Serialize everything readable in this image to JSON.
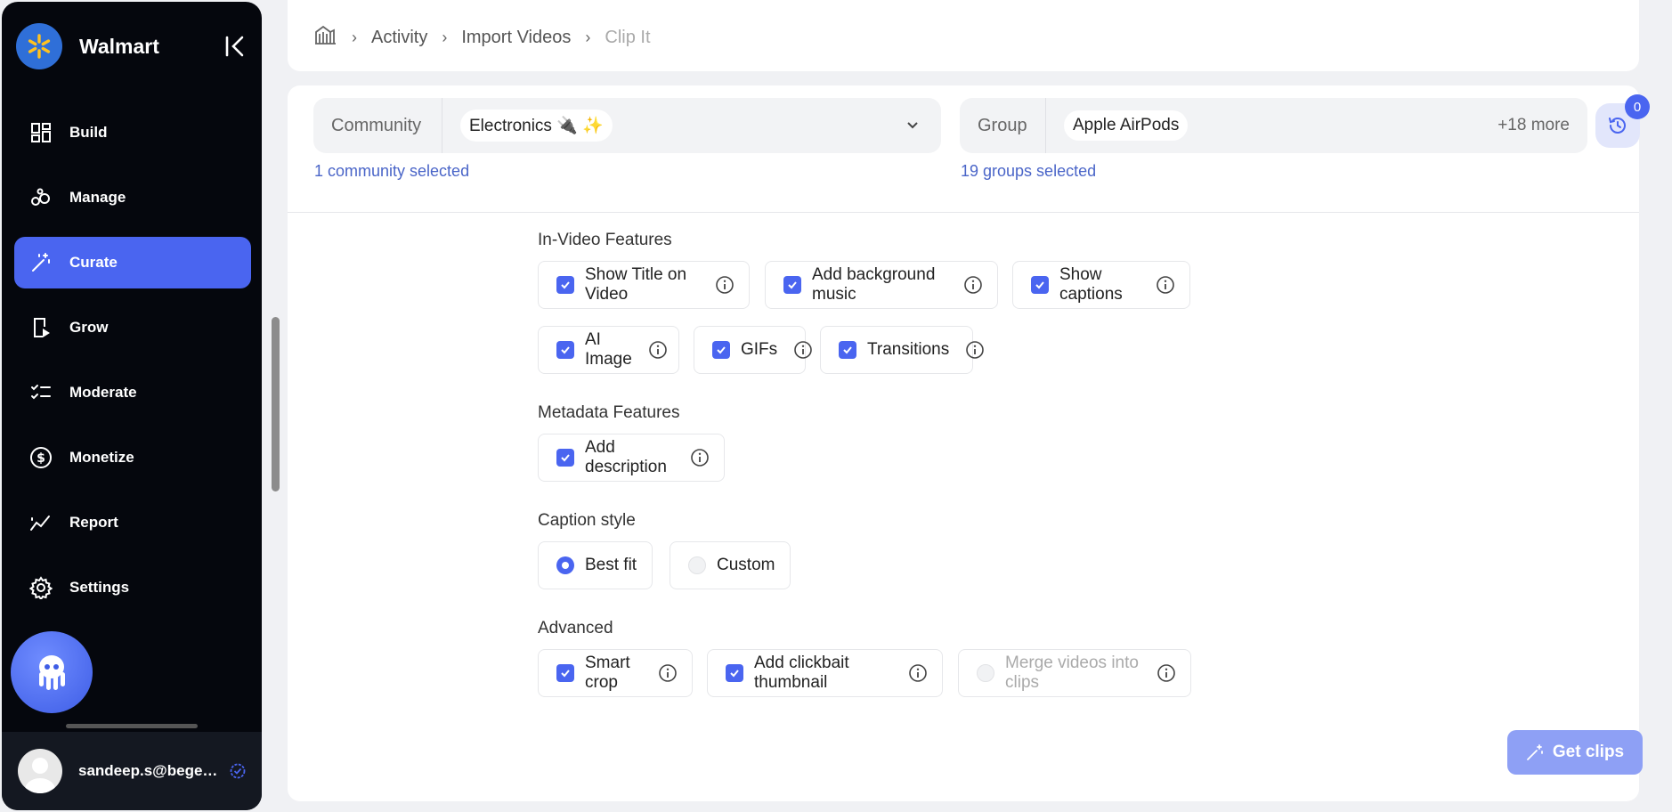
{
  "sidebar": {
    "brand": "Walmart",
    "items": [
      {
        "label": "Build"
      },
      {
        "label": "Manage"
      },
      {
        "label": "Curate"
      },
      {
        "label": "Grow"
      },
      {
        "label": "Moderate"
      },
      {
        "label": "Monetize"
      },
      {
        "label": "Report"
      },
      {
        "label": "Settings"
      }
    ],
    "active_item": "Curate",
    "user_email": "sandeep.s@begen..."
  },
  "breadcrumb": [
    "Activity",
    "Import Videos",
    "Clip It"
  ],
  "filters": {
    "community": {
      "label": "Community",
      "chip": "Electronics 🔌 ✨",
      "note": "1 community selected"
    },
    "group": {
      "label": "Group",
      "chip": "Apple AirPods",
      "more": "+18 more",
      "note": "19 groups selected"
    },
    "history_badge": "0"
  },
  "sections": {
    "in_video": {
      "title": "In-Video Features",
      "options": [
        {
          "label": "Show Title on Video",
          "checked": true
        },
        {
          "label": "Add background music",
          "checked": true
        },
        {
          "label": "Show captions",
          "checked": true
        },
        {
          "label": "AI Image",
          "checked": true
        },
        {
          "label": "GIFs",
          "checked": true
        },
        {
          "label": "Transitions",
          "checked": true
        }
      ]
    },
    "metadata": {
      "title": "Metadata Features",
      "options": [
        {
          "label": "Add description",
          "checked": true
        }
      ]
    },
    "caption_style": {
      "title": "Caption style",
      "options": [
        {
          "label": "Best fit",
          "selected": true
        },
        {
          "label": "Custom",
          "selected": false
        }
      ]
    },
    "advanced": {
      "title": "Advanced",
      "options": [
        {
          "label": "Smart crop",
          "checked": true
        },
        {
          "label": "Add clickbait thumbnail",
          "checked": true
        },
        {
          "label": "Merge videos into clips",
          "checked": false,
          "disabled": true
        }
      ]
    }
  },
  "actions": {
    "get_clips": "Get clips"
  },
  "colors": {
    "accent": "#4a65f0",
    "sidebar_bg": "#05070d",
    "button_disabled": "#8ea0f5"
  }
}
